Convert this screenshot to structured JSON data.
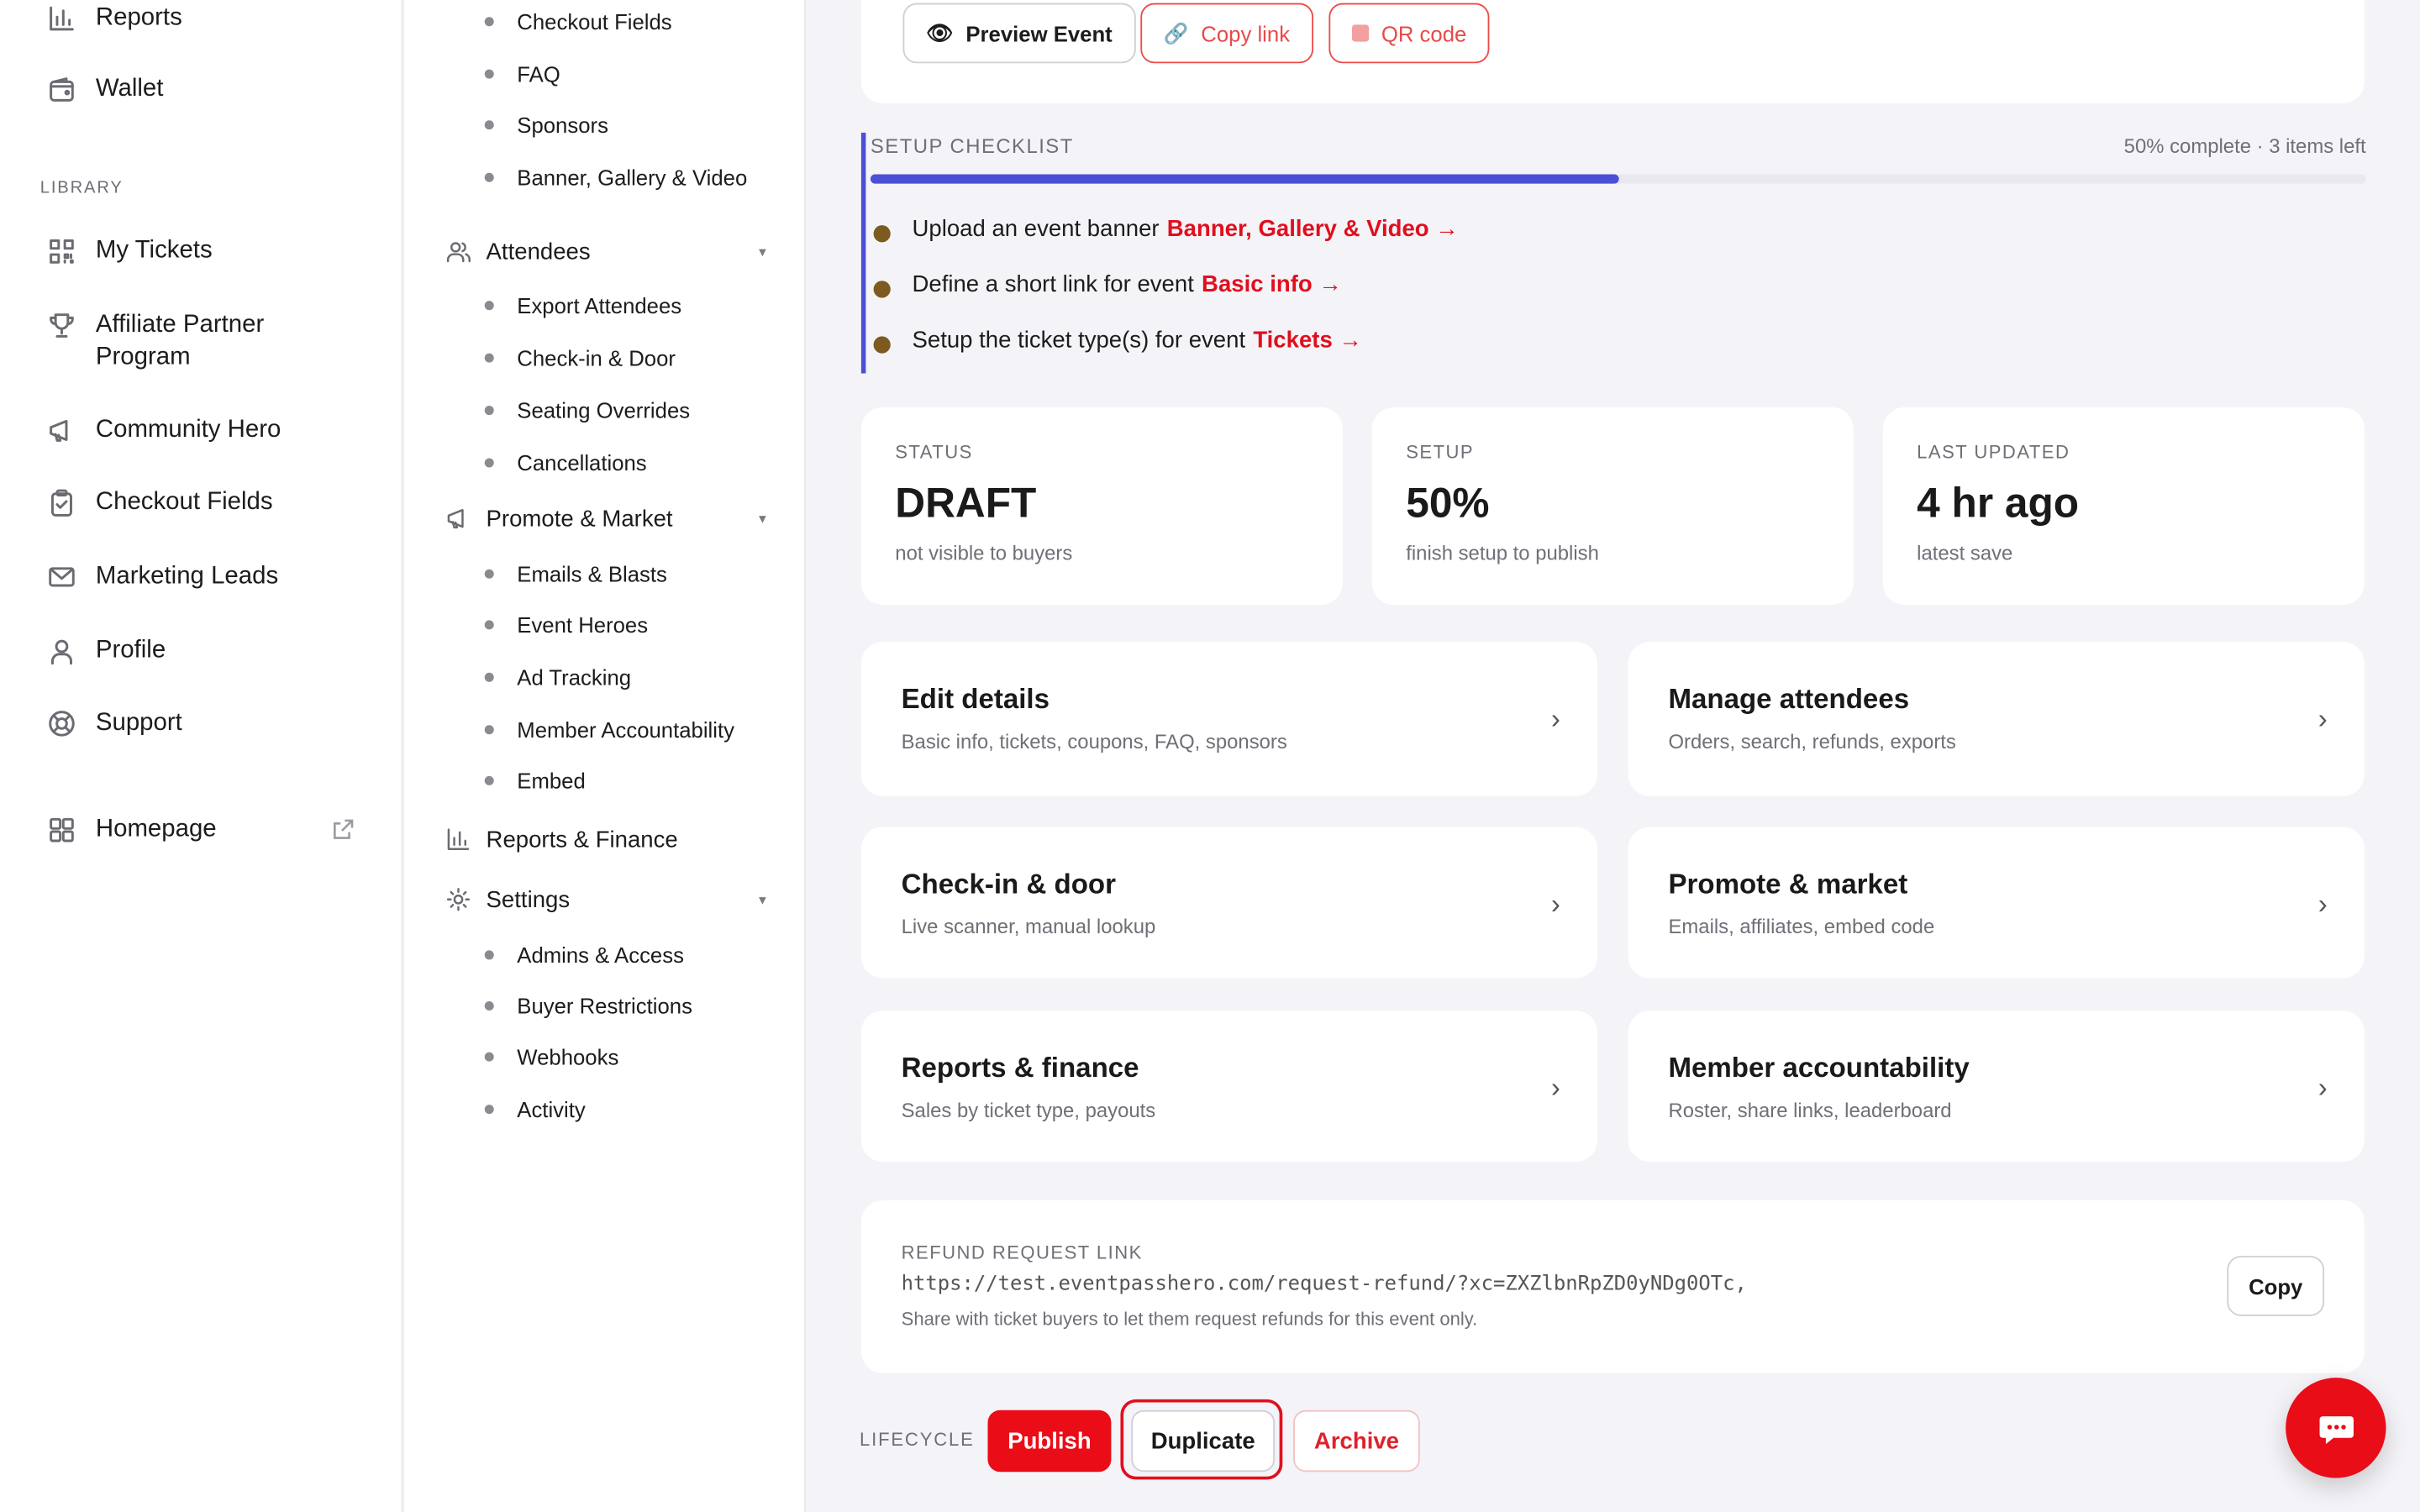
{
  "sidebar": {
    "items_top": [
      {
        "label": "Reports",
        "icon": "bar-chart-icon"
      },
      {
        "label": "Wallet",
        "icon": "wallet-icon"
      }
    ],
    "library_heading": "LIBRARY",
    "library_items": [
      {
        "label": "My Tickets",
        "icon": "qr-icon"
      },
      {
        "label": "Affiliate Partner",
        "label2": "Program",
        "icon": "trophy-icon"
      },
      {
        "label": "Community Hero",
        "icon": "megaphone-icon"
      },
      {
        "label": "Checkout Fields",
        "icon": "clipboard-icon"
      },
      {
        "label": "Marketing Leads",
        "icon": "mail-icon"
      },
      {
        "label": "Profile",
        "icon": "user-icon"
      },
      {
        "label": "Support",
        "icon": "lifebuoy-icon"
      }
    ],
    "homepage": {
      "label": "Homepage",
      "icon": "grid-icon",
      "external_icon": "external-link-icon"
    }
  },
  "subnav": {
    "top_items": [
      "Checkout Fields",
      "FAQ",
      "Sponsors",
      "Banner, Gallery & Video"
    ],
    "attendees": {
      "label": "Attendees",
      "items": [
        "Export Attendees",
        "Check-in & Door",
        "Seating Overrides",
        "Cancellations"
      ]
    },
    "promote": {
      "label": "Promote & Market",
      "items": [
        "Emails & Blasts",
        "Event Heroes",
        "Ad Tracking",
        "Member Accountability",
        "Embed"
      ]
    },
    "reports": {
      "label": "Reports & Finance"
    },
    "settings": {
      "label": "Settings",
      "items": [
        "Admins & Access",
        "Buyer Restrictions",
        "Webhooks",
        "Activity"
      ]
    }
  },
  "toolbar": {
    "preview_label": "Preview Event",
    "copy_label": "Copy link",
    "qr_label": "QR code"
  },
  "checklist": {
    "title": "SETUP CHECKLIST",
    "status": "50% complete · 3 items left",
    "progress": 0.5,
    "items": [
      {
        "text": "Upload an event banner",
        "link": "Banner, Gallery & Video →"
      },
      {
        "text": "Define a short link for event",
        "link": "Basic info →"
      },
      {
        "text": "Setup the ticket type(s) for event",
        "link": "Tickets →"
      }
    ]
  },
  "stats": [
    {
      "key": "STATUS",
      "value": "DRAFT",
      "note": "not visible to buyers"
    },
    {
      "key": "SETUP",
      "value": "50%",
      "note": "finish setup to publish"
    },
    {
      "key": "LAST UPDATED",
      "value": "4 hr ago",
      "note": "latest save"
    }
  ],
  "cards": [
    {
      "title": "Edit details",
      "desc": "Basic info, tickets, coupons, FAQ, sponsors"
    },
    {
      "title": "Manage attendees",
      "desc": "Orders, search, refunds, exports"
    },
    {
      "title": "Check-in & door",
      "desc": "Live scanner, manual lookup"
    },
    {
      "title": "Promote & market",
      "desc": "Emails, affiliates, embed code"
    },
    {
      "title": "Reports & finance",
      "desc": "Sales by ticket type, payouts"
    },
    {
      "title": "Member accountability",
      "desc": "Roster, share links, leaderboard"
    }
  ],
  "chevron": "›",
  "refund": {
    "label": "REFUND REQUEST LINK",
    "url": "https://test.eventpasshero.com/request-refund/?xc=ZXZlbnRpZD0yNDg0OTc,",
    "hint": "Share with ticket buyers to let them request refunds for this event only.",
    "copy_label": "Copy"
  },
  "lifecycle": {
    "label": "LIFECYCLE",
    "publish": "Publish",
    "duplicate": "Duplicate",
    "archive": "Archive"
  },
  "colors": {
    "accent": "#e00f1e",
    "progress": "#4b4fd6",
    "bullet": "#7d5a1f"
  }
}
